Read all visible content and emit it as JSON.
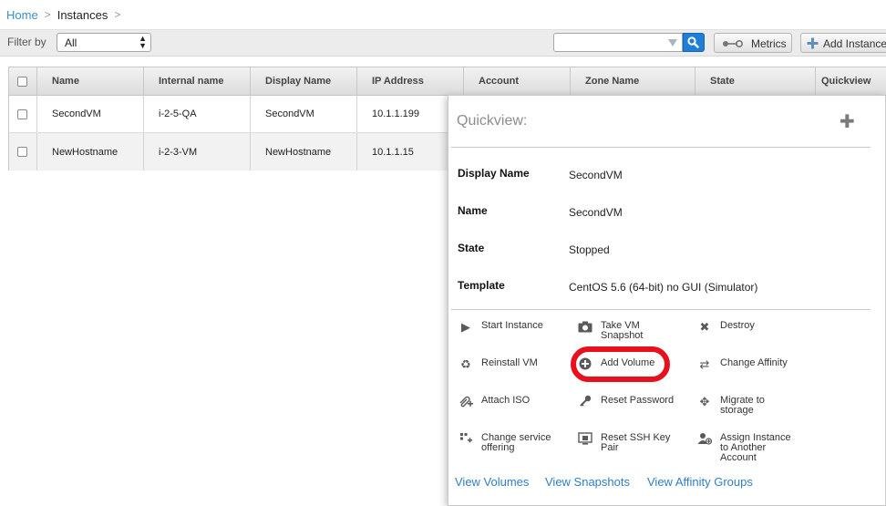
{
  "breadcrumb": {
    "home": "Home",
    "separator": ">",
    "current": "Instances",
    "trailing": ">"
  },
  "toolbar": {
    "filter_label": "Filter by",
    "filter_value": "All",
    "search_value": "",
    "metrics_label": "Metrics",
    "add_label": "Add Instance"
  },
  "table": {
    "headers": [
      "Name",
      "Internal name",
      "Display Name",
      "IP Address",
      "Account",
      "Zone Name",
      "State",
      "Quickview"
    ],
    "rows": [
      [
        "SecondVM",
        "i-2-5-QA",
        "SecondVM",
        "10.1.1.199"
      ],
      [
        "NewHostname",
        "i-2-3-VM",
        "NewHostname",
        "10.1.1.15"
      ]
    ]
  },
  "quickview": {
    "title": "Quickview:",
    "details": [
      {
        "label": "Display Name",
        "value": "SecondVM"
      },
      {
        "label": "Name",
        "value": "SecondVM"
      },
      {
        "label": "State",
        "value": "Stopped"
      },
      {
        "label": "Template",
        "value": "CentOS 5.6 (64-bit) no GUI (Simulator)"
      }
    ],
    "actions": [
      {
        "label": "Start Instance",
        "icon": "play-icon"
      },
      {
        "label": "Take VM Snapshot",
        "icon": "camera-icon"
      },
      {
        "label": "Destroy",
        "icon": "close-icon"
      },
      {
        "label": "Reinstall VM",
        "icon": "recycle-icon"
      },
      {
        "label": "Add Volume",
        "icon": "plus-circle-icon"
      },
      {
        "label": "Change Affinity",
        "icon": "swap-icon"
      },
      {
        "label": "Attach ISO",
        "icon": "paperclip-icon"
      },
      {
        "label": "Reset Password",
        "icon": "key-icon"
      },
      {
        "label": "Migrate to storage",
        "icon": "move-icon"
      },
      {
        "label": "Change service offering",
        "icon": "grid-plus-icon"
      },
      {
        "label": "Reset SSH Key Pair",
        "icon": "ssh-key-icon"
      },
      {
        "label": "Assign Instance to Another Account",
        "icon": "user-plus-icon"
      }
    ],
    "links": [
      "View Volumes",
      "View Snapshots",
      "View Affinity Groups"
    ]
  },
  "colors": {
    "link": "#2f7fc6",
    "search_button": "#1f7fd6",
    "highlight": "#e8101c"
  }
}
